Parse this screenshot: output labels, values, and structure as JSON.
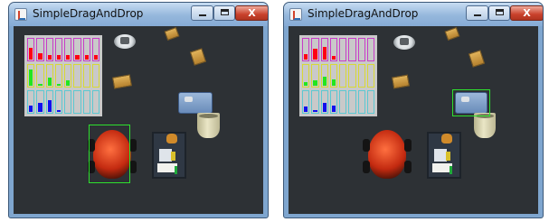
{
  "windows": [
    {
      "title": "SimpleDragAndDrop",
      "controls": {
        "minimize": "minimize-icon",
        "maximize": "maximize-icon",
        "close_glyph": "X"
      },
      "hud": {
        "magenta": [
          0.6,
          0.3,
          0.22,
          0.22,
          0.22,
          0.22,
          0.22,
          0.22
        ],
        "yellow": [
          0.8,
          0.1,
          0.4,
          0.1,
          0.25,
          0,
          0,
          0
        ],
        "cyan": [
          0.3,
          0.45,
          0.6,
          0.1,
          0,
          0,
          0,
          0
        ]
      },
      "selection": "robot"
    },
    {
      "title": "SimpleDragAndDrop",
      "controls": {
        "minimize": "minimize-icon",
        "maximize": "maximize-icon",
        "close_glyph": "X"
      },
      "hud": {
        "magenta": [
          0.25,
          0.55,
          0.65,
          0.2,
          0,
          0,
          0,
          0
        ],
        "yellow": [
          0.2,
          0.25,
          0.45,
          0.3,
          0,
          0,
          0,
          0
        ],
        "cyan": [
          0.25,
          0.1,
          0.45,
          0.3,
          0,
          0,
          0,
          0
        ]
      },
      "selection": "basket"
    }
  ],
  "colors": {
    "magenta_fill": "#ff0014",
    "yellow_fill": "#22e61e",
    "cyan_fill": "#1010ee",
    "selection_box": "#2ee02e",
    "close_button": "#c9412c"
  }
}
